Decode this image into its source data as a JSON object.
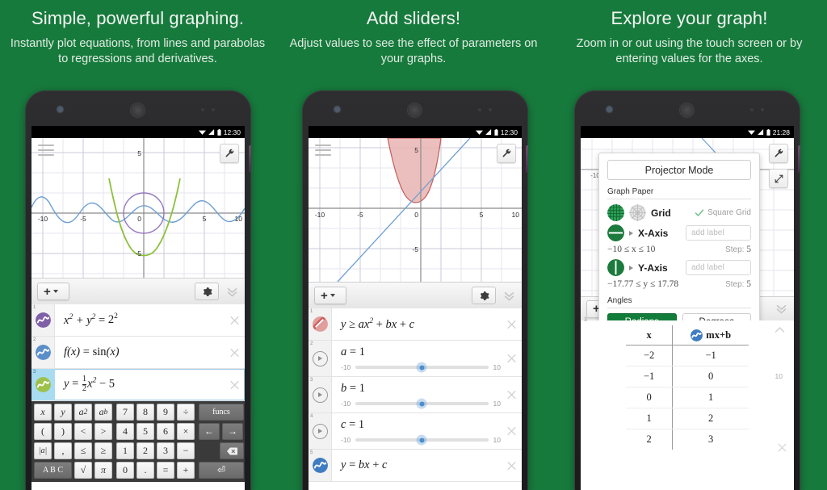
{
  "theme": {
    "background": "#177a3d",
    "accent_green": "#127c3a",
    "blue": "#4a8fd0",
    "purple": "#8a6fb5",
    "olive": "#8fc03f",
    "red": "#d9625f"
  },
  "panels": [
    {
      "headline": "Simple, powerful graphing.",
      "subline": "Instantly plot equations, from lines and parabolas to regressions and derivatives.",
      "status_time": "12:30",
      "toolbar": {
        "add_label": "+",
        "gear_icon": "gear-icon",
        "collapse_icon": "double-chevron-down-icon",
        "wrench_icon": "wrench-icon"
      },
      "graph": {
        "x_ticks": [
          "-10",
          "-5",
          "0",
          "5",
          "10"
        ],
        "y_ticks": [
          "5",
          "-5"
        ]
      },
      "expressions": [
        {
          "index": "1",
          "color": "#8a6fb5",
          "kind": "curve",
          "active": false
        },
        {
          "index": "2",
          "color": "#5b8fc9",
          "kind": "curve",
          "active": false
        },
        {
          "index": "3",
          "color": "#9dc martian",
          "kind": "curve",
          "active": true
        }
      ],
      "keyboard": {
        "left": [
          [
            "x",
            "y",
            "a2",
            "ab"
          ],
          [
            "(",
            ")",
            "<",
            ">"
          ],
          [
            "|a|",
            ",",
            "≤",
            "≥"
          ],
          [
            "A B C",
            "√",
            "π"
          ]
        ],
        "mid": [
          [
            "7",
            "8",
            "9",
            "÷"
          ],
          [
            "4",
            "5",
            "6",
            "×"
          ],
          [
            "1",
            "2",
            "3",
            "−"
          ],
          [
            "0",
            ".",
            "=",
            "+"
          ]
        ],
        "right": [
          [
            "funcs"
          ],
          [
            "←",
            "→"
          ],
          [
            "⌫"
          ],
          [
            "↵"
          ]
        ]
      }
    },
    {
      "headline": "Add sliders!",
      "subline": "Adjust values to see the effect of parameters on your graphs.",
      "status_time": "12:30",
      "graph": {
        "x_ticks": [
          "-10",
          "-5",
          "0",
          "5",
          "10"
        ],
        "y_ticks": [
          "5",
          "-5"
        ]
      },
      "sliders": [
        {
          "index": "2",
          "name": "a",
          "value": "1",
          "min": "-10",
          "max": "10"
        },
        {
          "index": "3",
          "name": "b",
          "value": "1",
          "min": "-10",
          "max": "10"
        },
        {
          "index": "4",
          "name": "c",
          "value": "1",
          "min": "-10",
          "max": "10"
        }
      ]
    },
    {
      "headline": "Explore your graph!",
      "subline": "Zoom in or out using the touch screen or by entering values for the axes.",
      "status_time": "21:28",
      "settings": {
        "projector_mode": "Projector Mode",
        "graph_paper_label": "Graph Paper",
        "grid_label": "Grid",
        "square_grid_label": "Square Grid",
        "square_grid_checked": true,
        "x_axis_label": "X-Axis",
        "x_axis_placeholder": "add label",
        "x_range": "−10 ≤ x ≤ 10",
        "x_step_label": "Step:",
        "x_step_value": "5",
        "y_axis_label": "Y-Axis",
        "y_axis_placeholder": "add label",
        "y_range": "−17.77 ≤ y ≤ 17.78",
        "y_step_label": "Step:",
        "y_step_value": "5",
        "angles_label": "Angles",
        "radians_label": "Radians",
        "degrees_label": "Degrees",
        "selected_angle": "Radians"
      },
      "table": {
        "headers": [
          "x",
          "mx+b"
        ],
        "rows": [
          [
            "−2",
            "−1"
          ],
          [
            "−1",
            "0"
          ],
          [
            "0",
            "1"
          ],
          [
            "1",
            "2"
          ],
          [
            "2",
            "3"
          ]
        ]
      },
      "background_labels": {
        "left_tick": "-10",
        "right_tick": "10",
        "slider_max": "10",
        "row_index": "3"
      }
    }
  ]
}
